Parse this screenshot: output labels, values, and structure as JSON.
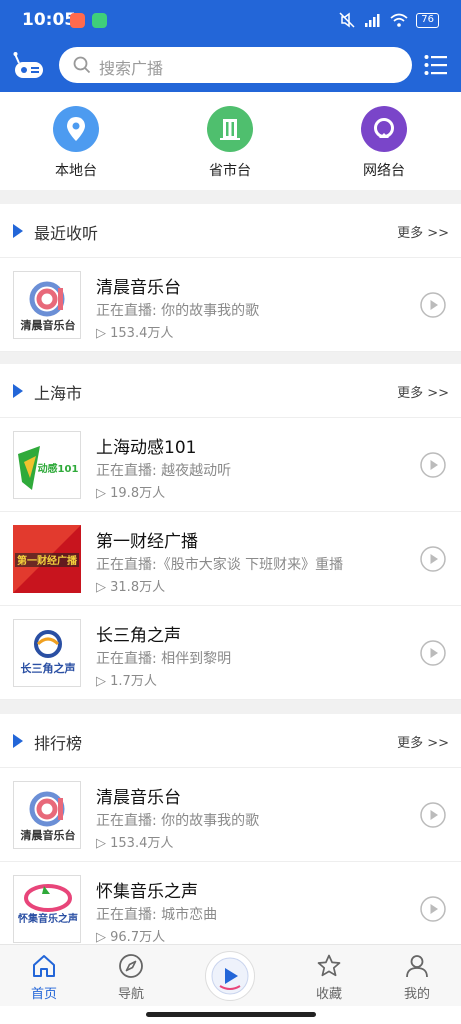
{
  "status": {
    "time": "10:05",
    "battery": "76"
  },
  "search": {
    "placeholder": "搜索广播"
  },
  "categories": [
    {
      "label": "本地台",
      "icon": "location-pin-icon",
      "color": "#4d9bf0"
    },
    {
      "label": "省市台",
      "icon": "building-icon",
      "color": "#4fbf6e"
    },
    {
      "label": "网络台",
      "icon": "network-icon",
      "color": "#7a45c9"
    }
  ],
  "sections": [
    {
      "title": "最近收听",
      "more": "更多 >>",
      "items": [
        {
          "name": "清晨音乐台",
          "live": "正在直播: 你的故事我的歌",
          "listeners": "153.4万人",
          "logo": "清晨音乐台"
        }
      ]
    },
    {
      "title": "上海市",
      "more": "更多 >>",
      "items": [
        {
          "name": "上海动感101",
          "live": "正在直播: 越夜越动听",
          "listeners": "19.8万人",
          "logo": "动感101"
        },
        {
          "name": "第一财经广播",
          "live": "正在直播:《股市大家谈 下班财来》重播",
          "listeners": "31.8万人",
          "logo": "第一财经广播"
        },
        {
          "name": "长三角之声",
          "live": "正在直播: 相伴到黎明",
          "listeners": "1.7万人",
          "logo": "长三角之声"
        }
      ]
    },
    {
      "title": "排行榜",
      "more": "更多 >>",
      "items": [
        {
          "name": "清晨音乐台",
          "live": "正在直播: 你的故事我的歌",
          "listeners": "153.4万人",
          "logo": "清晨音乐台"
        },
        {
          "name": "怀集音乐之声",
          "live": "正在直播: 城市恋曲",
          "listeners": "96.7万人",
          "logo": "怀集音乐之声"
        }
      ]
    }
  ],
  "tabs": [
    {
      "label": "首页",
      "icon": "home-icon",
      "active": true
    },
    {
      "label": "导航",
      "icon": "compass-icon",
      "active": false
    },
    {
      "label": "收藏",
      "icon": "star-icon",
      "active": false
    },
    {
      "label": "我的",
      "icon": "user-icon",
      "active": false
    }
  ],
  "colors": {
    "primary": "#2366d8",
    "tab_active": "#2366d8",
    "divider": "#f1f1f1"
  }
}
